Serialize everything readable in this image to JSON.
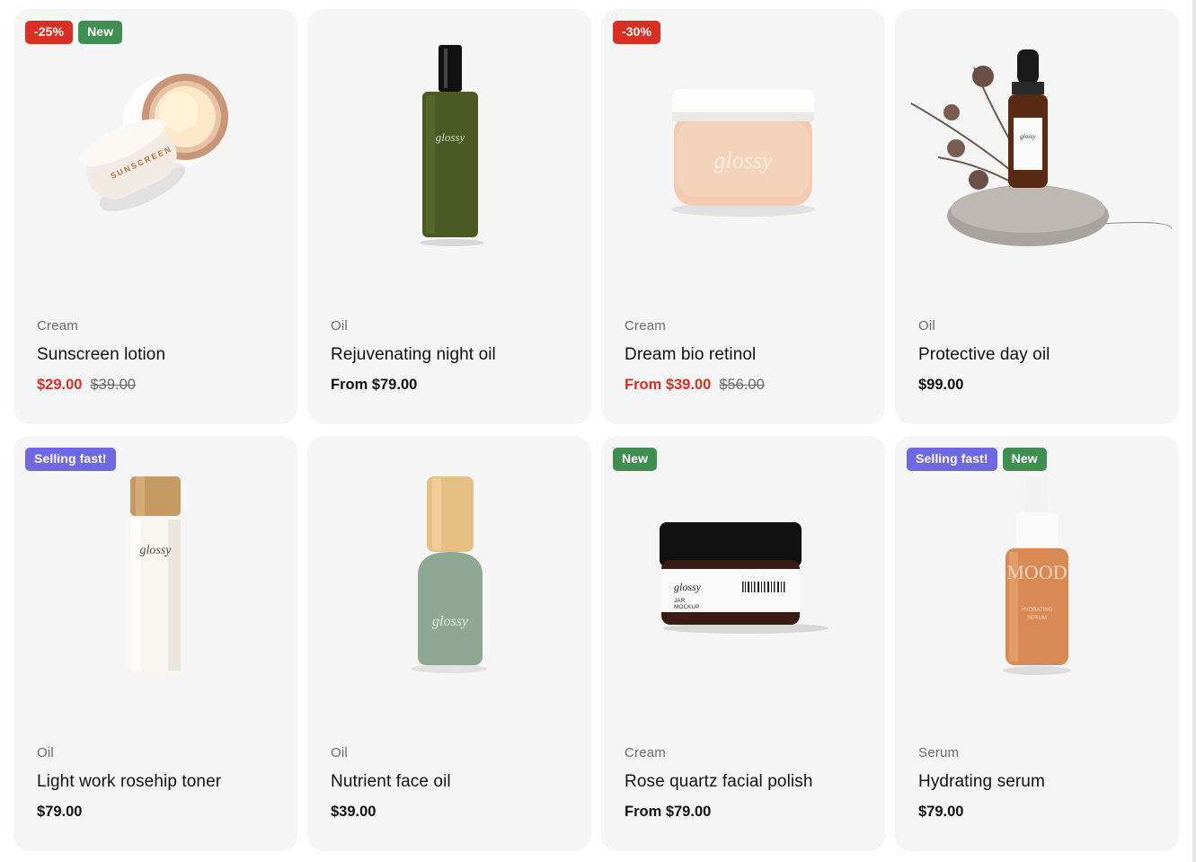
{
  "products": [
    {
      "badges": [
        {
          "text": "-25%",
          "type": "discount"
        },
        {
          "text": "New",
          "type": "new"
        }
      ],
      "image_icon": "sunscreen-jar-image",
      "image_brand": "SUNSCREEN",
      "category": "Cream",
      "title": "Sunscreen lotion",
      "price": "$29.00",
      "compare_price": "$39.00",
      "on_sale": true
    },
    {
      "badges": [],
      "image_icon": "green-oil-bottle-image",
      "image_brand": "glossy",
      "category": "Oil",
      "title": "Rejuvenating night oil",
      "price": "From $79.00",
      "compare_price": "",
      "on_sale": false
    },
    {
      "badges": [
        {
          "text": "-30%",
          "type": "discount"
        }
      ],
      "image_icon": "peach-cream-jar-image",
      "image_brand": "glossy",
      "category": "Cream",
      "title": "Dream bio retinol",
      "price": "From $39.00",
      "compare_price": "$56.00",
      "on_sale": true
    },
    {
      "badges": [],
      "image_icon": "dropper-bottle-on-stone-image",
      "image_brand": "glossy",
      "category": "Oil",
      "title": "Protective day oil",
      "price": "$99.00",
      "compare_price": "",
      "on_sale": false
    },
    {
      "badges": [
        {
          "text": "Selling fast!",
          "type": "fast"
        }
      ],
      "image_icon": "clear-toner-bottle-image",
      "image_brand": "glossy",
      "category": "Oil",
      "title": "Light work rosehip toner",
      "price": "$79.00",
      "compare_price": "",
      "on_sale": false
    },
    {
      "badges": [],
      "image_icon": "sage-pump-bottle-image",
      "image_brand": "glossy",
      "category": "Oil",
      "title": "Nutrient face oil",
      "price": "$39.00",
      "compare_price": "",
      "on_sale": false
    },
    {
      "badges": [
        {
          "text": "New",
          "type": "new"
        }
      ],
      "image_icon": "black-jar-image",
      "image_brand": "glossy",
      "category": "Cream",
      "title": "Rose quartz facial polish",
      "price": "From $79.00",
      "compare_price": "",
      "on_sale": false
    },
    {
      "badges": [
        {
          "text": "Selling fast!",
          "type": "fast"
        },
        {
          "text": "New",
          "type": "new"
        }
      ],
      "image_icon": "orange-serum-bottle-image",
      "image_brand": "MOOD",
      "category": "Serum",
      "title": "Hydrating serum",
      "price": "$79.00",
      "compare_price": "",
      "on_sale": false
    }
  ],
  "colors": {
    "card_bg": "#f5f5f5",
    "sale": "#d93025",
    "badge_new": "#3f8f51",
    "badge_fast": "#6f68e0",
    "text": "#111111",
    "muted": "#6b6b6b"
  }
}
